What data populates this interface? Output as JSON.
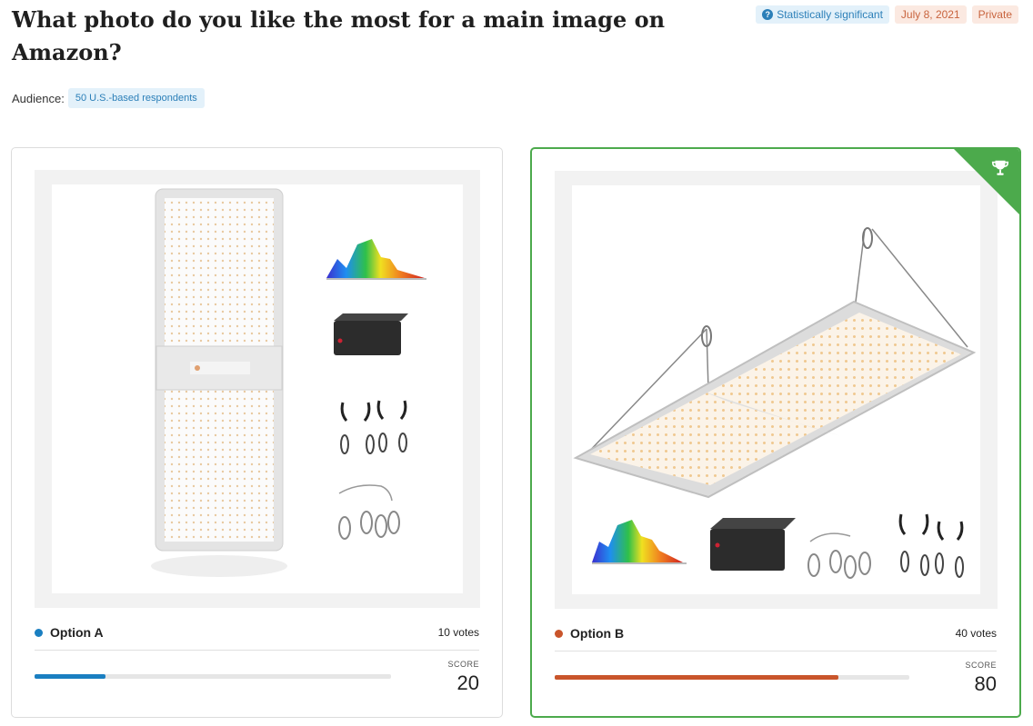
{
  "header": {
    "title": "What photo do you like the most for a main image on Amazon?",
    "badges": {
      "significance": "Statistically significant",
      "date": "July 8, 2021",
      "visibility": "Private"
    }
  },
  "audience": {
    "label": "Audience:",
    "value": "50 U.S.-based respondents"
  },
  "options": [
    {
      "name": "Option A",
      "votes": "10 votes",
      "score_label": "SCORE",
      "score": "20",
      "score_fraction": 0.2,
      "color": "#1a7fc1",
      "winner": false,
      "image_alt": "vertical LED grow light panel with spectrum chart, driver box, rope hangers and steel cables"
    },
    {
      "name": "Option B",
      "votes": "40 votes",
      "score_label": "SCORE",
      "score": "80",
      "score_fraction": 0.8,
      "color": "#c9552b",
      "winner": true,
      "winner_icon": "trophy-icon",
      "image_alt": "hanging LED grow light panel in perspective with spectrum chart, driver box, steel cables and rope hangers"
    }
  ],
  "colors": {
    "winner_border": "#4caa4c",
    "badge_blue": "#2b7fb8",
    "badge_orange": "#c8643e"
  }
}
